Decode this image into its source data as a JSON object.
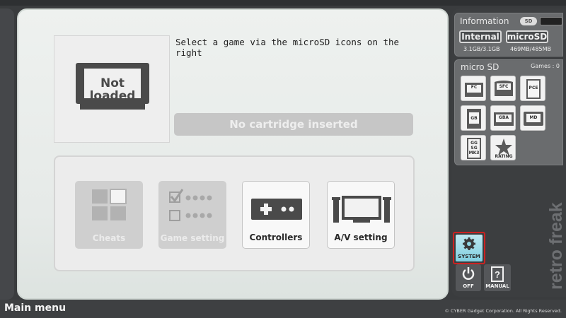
{
  "main": {
    "cartridge_label_line1": "Not",
    "cartridge_label_line2": "loaded",
    "hint": "Select a game via the microSD icons on the right",
    "status": "No cartridge inserted",
    "menu": [
      {
        "label": "Cheats",
        "enabled": false
      },
      {
        "label": "Game setting",
        "enabled": false
      },
      {
        "label": "Controllers",
        "enabled": true
      },
      {
        "label": "A/V setting",
        "enabled": true
      }
    ]
  },
  "sidebar": {
    "info_title": "Information",
    "sd_badge": "SD",
    "internal_label": "Internal",
    "internal_value": "3.1GB/3.1GB",
    "microsd_label": "microSD",
    "microsd_value": "469MB/485MB",
    "sd_title": "micro SD",
    "games_count": "Games : 0",
    "systems": [
      "FC",
      "SFC",
      "PCE",
      "GB",
      "GBA",
      "MD",
      "GG SG MK3",
      "RATING"
    ],
    "brand": "retro freak",
    "system_label": "SYSTEM",
    "off_label": "OFF",
    "manual_label": "MANUAL"
  },
  "footer": {
    "title": "Main menu",
    "copyright": "© CYBER Gadget Corporation. All Rights Reserved."
  },
  "colors": {
    "panel_bg": "#e8ecea",
    "sidebar_bg": "#3c3e40",
    "system_highlight": "#cc2222",
    "system_btn": "#7fcfe0"
  }
}
